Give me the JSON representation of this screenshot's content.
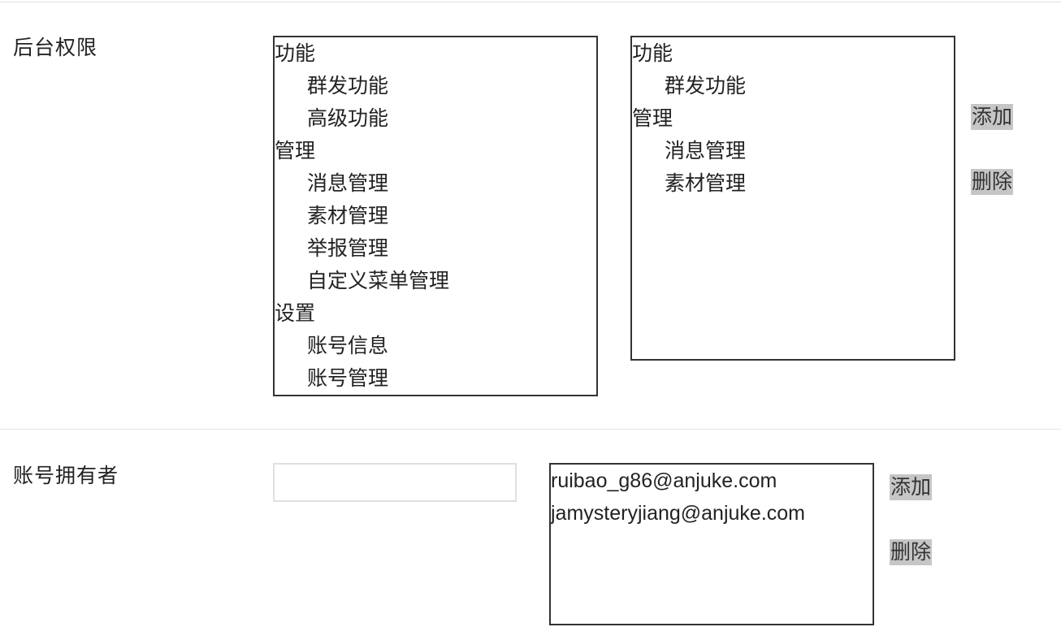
{
  "permissions": {
    "label": "后台权限",
    "available": [
      {
        "text": "功能",
        "level": "group"
      },
      {
        "text": "群发功能",
        "level": "child"
      },
      {
        "text": "高级功能",
        "level": "child"
      },
      {
        "text": "管理",
        "level": "group"
      },
      {
        "text": "消息管理",
        "level": "child"
      },
      {
        "text": "素材管理",
        "level": "child"
      },
      {
        "text": "举报管理",
        "level": "child"
      },
      {
        "text": "自定义菜单管理",
        "level": "child"
      },
      {
        "text": "设置",
        "level": "group"
      },
      {
        "text": "账号信息",
        "level": "child"
      },
      {
        "text": "账号管理",
        "level": "child"
      }
    ],
    "selected": [
      {
        "text": "功能",
        "level": "group"
      },
      {
        "text": "群发功能",
        "level": "child"
      },
      {
        "text": "管理",
        "level": "group"
      },
      {
        "text": "消息管理",
        "level": "child"
      },
      {
        "text": "素材管理",
        "level": "child"
      }
    ],
    "add_label": "添加",
    "delete_label": "删除"
  },
  "owners": {
    "label": "账号拥有者",
    "input_value": "",
    "input_placeholder": "",
    "emails": [
      "ruibao_g86@anjuke.com",
      "jamysteryjiang@anjuke.com"
    ],
    "add_label": "添加",
    "delete_label": "删除"
  }
}
